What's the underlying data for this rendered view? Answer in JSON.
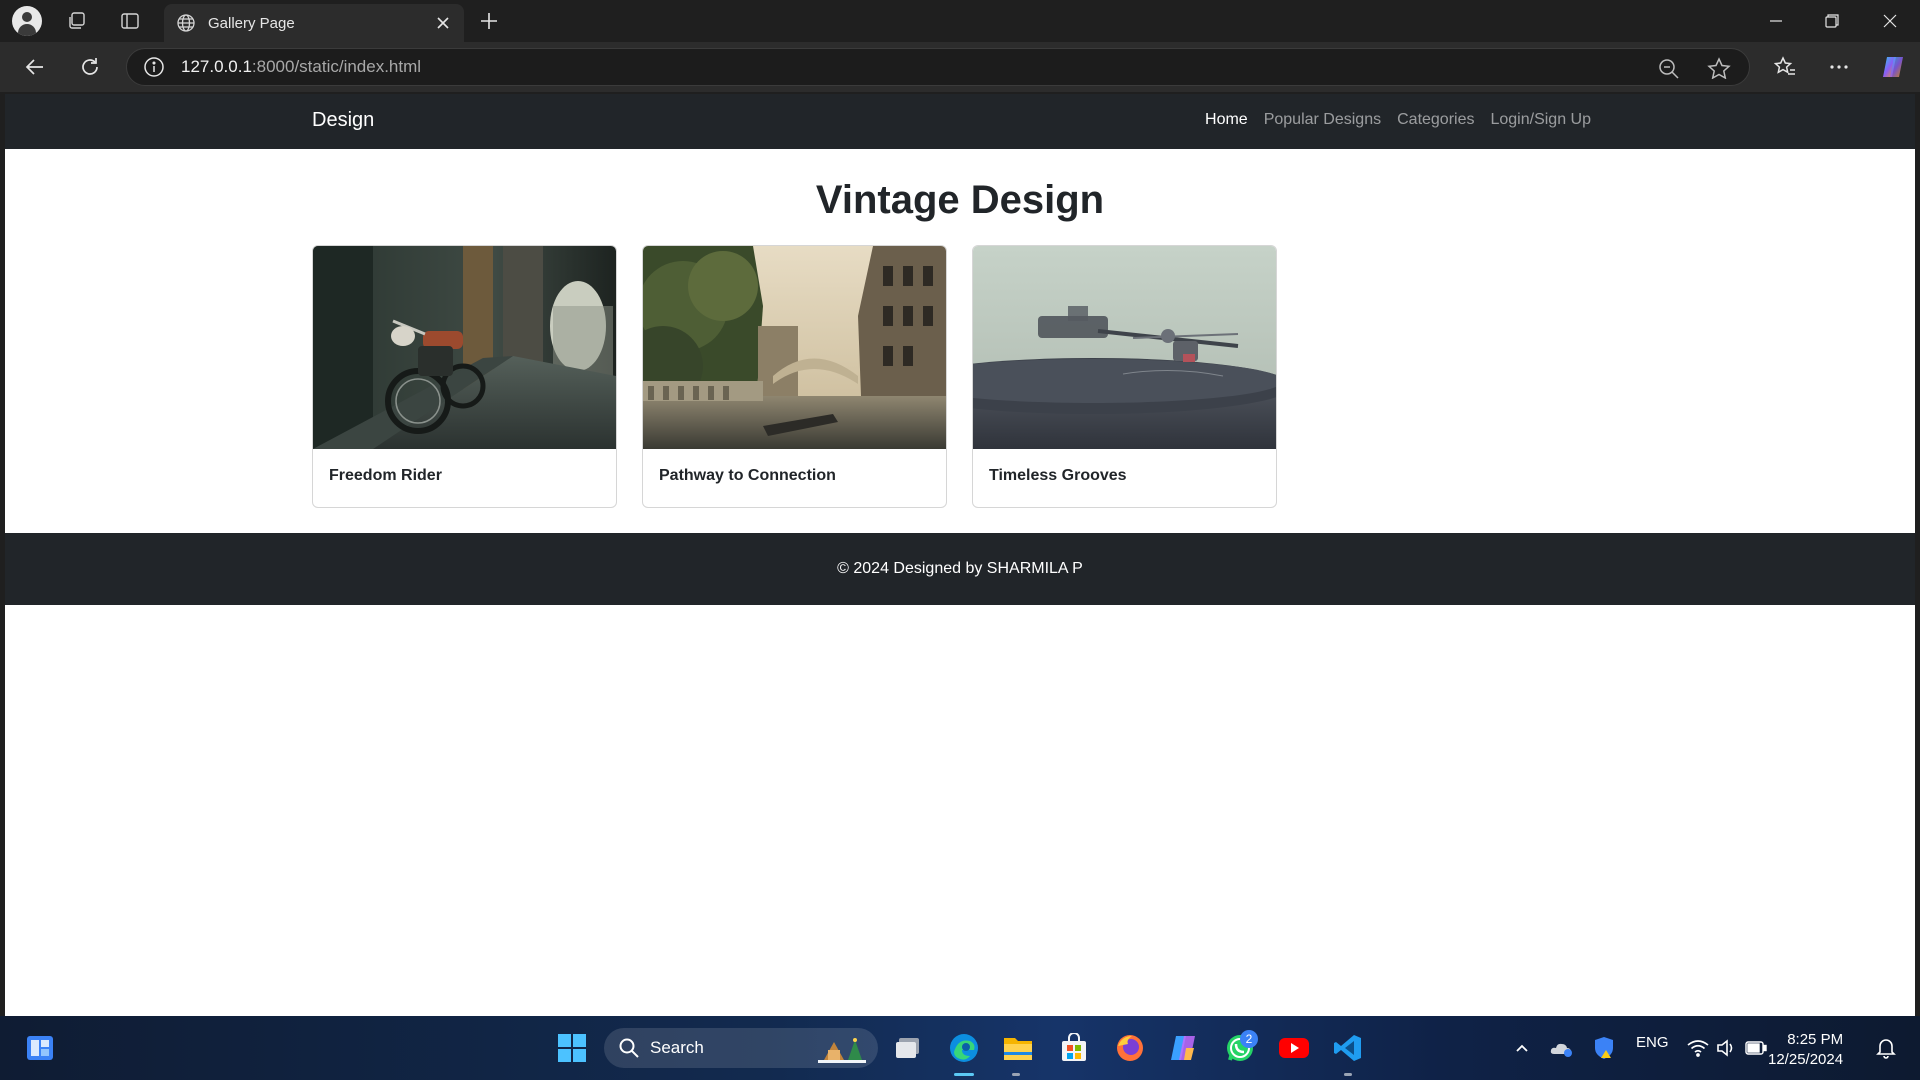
{
  "browser": {
    "tab_title": "Gallery Page",
    "url_host": "127.0.0.1",
    "url_rest": ":8000/static/index.html"
  },
  "site": {
    "brand": "Design",
    "nav": [
      {
        "label": "Home",
        "active": true
      },
      {
        "label": "Popular Designs",
        "active": false
      },
      {
        "label": "Categories",
        "active": false
      },
      {
        "label": "Login/Sign Up",
        "active": false
      }
    ],
    "page_title": "Vintage Design",
    "cards": [
      {
        "title": "Freedom Rider",
        "image": "motorcycle-street-photo"
      },
      {
        "title": "Pathway to Connection",
        "image": "venice-canal-photo"
      },
      {
        "title": "Timeless Grooves",
        "image": "record-player-photo"
      }
    ],
    "footer": "© 2024 Designed by SHARMILA P"
  },
  "taskbar": {
    "search_label": "Search",
    "whatsapp_badge": "2",
    "language": "ENG",
    "time": "8:25 PM",
    "date": "12/25/2024"
  }
}
